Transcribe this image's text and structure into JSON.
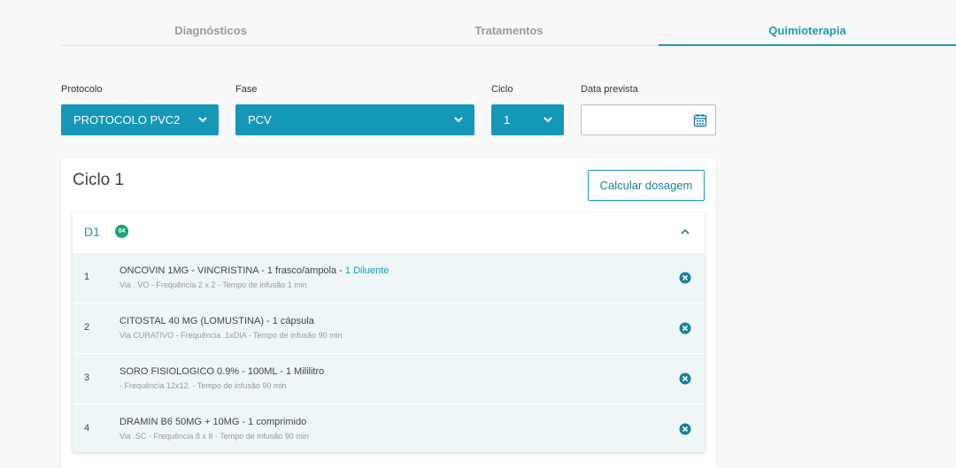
{
  "tabs": [
    {
      "label": "Diagnósticos",
      "active": false
    },
    {
      "label": "Tratamentos",
      "active": false
    },
    {
      "label": "Quimioterapia",
      "active": true
    }
  ],
  "form": {
    "protocolo": {
      "label": "Protocolo",
      "value": "PROTOCOLO PVC2"
    },
    "fase": {
      "label": "Fase",
      "value": "PCV"
    },
    "ciclo": {
      "label": "Ciclo",
      "value": "1"
    },
    "data_prevista": {
      "label": "Data prevista",
      "value": ""
    }
  },
  "card": {
    "title": "Ciclo 1",
    "calc_button": "Calcular dosagem",
    "day": {
      "label": "D1",
      "badge": "04"
    },
    "items": [
      {
        "num": "1",
        "title": "ONCOVIN 1MG - VINCRISTINA - 1 frasco/ampola - ",
        "diluent": "1 Diluente",
        "sub": "Via . VO - Frequência 2 x 2 - Tempo de infusão 1 min"
      },
      {
        "num": "2",
        "title": "CITOSTAL 40 MG (LOMUSTINA) - 1 cápsula",
        "diluent": "",
        "sub": "Via CURATIVO - Frequência .1xDIA - Tempo de infusão 90 min"
      },
      {
        "num": "3",
        "title": "SORO FISIOLOGICO 0.9% - 100ML - 1 Mililitro",
        "diluent": "",
        "sub": "- Frequência 12x12. - Tempo de infusão 90 min"
      },
      {
        "num": "4",
        "title": "DRAMIN B6 50MG + 10MG - 1 comprimido",
        "diluent": "",
        "sub": "Via .SC - Frequência 8 x 8 - Tempo de infusão 90 min"
      }
    ]
  },
  "colors": {
    "accent": "#1a9ab8",
    "select_bg": "#1597b8",
    "badge": "#1aa37a",
    "row_bg": "#eef6f8"
  },
  "icons": {
    "select_chevron": "chevron-down-icon",
    "date": "calendar-icon",
    "collapse": "chevron-up-icon",
    "remove": "close-circle-icon"
  }
}
